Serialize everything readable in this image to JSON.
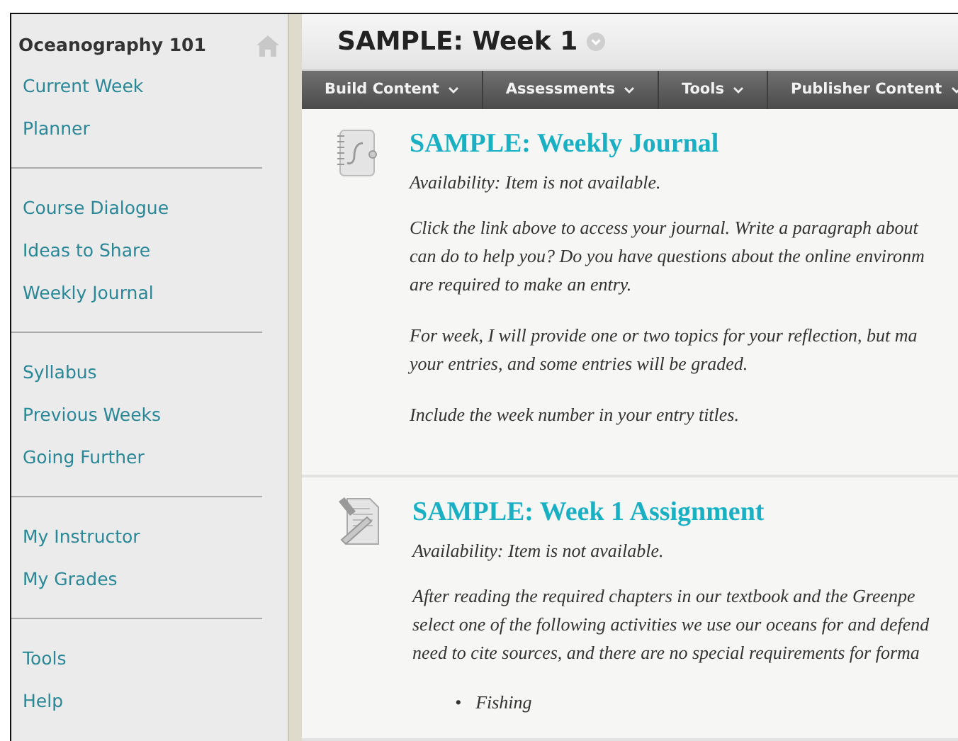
{
  "sidebar": {
    "title": "Oceanography 101",
    "groups": [
      [
        "Current Week",
        "Planner"
      ],
      [
        "Course Dialogue",
        "Ideas to Share",
        "Weekly Journal"
      ],
      [
        "Syllabus",
        "Previous Weeks",
        "Going Further"
      ],
      [
        "My Instructor",
        "My Grades"
      ],
      [
        "Tools",
        "Help"
      ]
    ]
  },
  "header": {
    "title": "SAMPLE: Week 1"
  },
  "toolbar": [
    "Build Content",
    "Assessments",
    "Tools",
    "Publisher Content"
  ],
  "items": [
    {
      "kind": "journal",
      "title": "SAMPLE: Weekly Journal",
      "availability": "Availability:  Item is not available.",
      "paragraphs": [
        [
          "Click the link above to access your journal. Write a paragraph about",
          "can do to help you? Do you have questions about the online environm",
          "are required to make an entry."
        ],
        [
          "For week, I will provide one or two topics for your reflection, but ma",
          "your entries, and some entries will be graded."
        ],
        [
          "Include the week number in your entry titles."
        ]
      ]
    },
    {
      "kind": "assignment",
      "title": "SAMPLE: Week 1 Assignment",
      "availability": "Availability:  Item is not available.",
      "paragraphs": [
        [
          "After reading the required chapters in our textbook and the Greenpe",
          "select one of the following activities we use our oceans for and defend",
          "need to cite sources, and there are no special requirements for forma"
        ]
      ],
      "bullets": [
        {
          "marker": "•",
          "text": "Fishing"
        }
      ]
    }
  ]
}
